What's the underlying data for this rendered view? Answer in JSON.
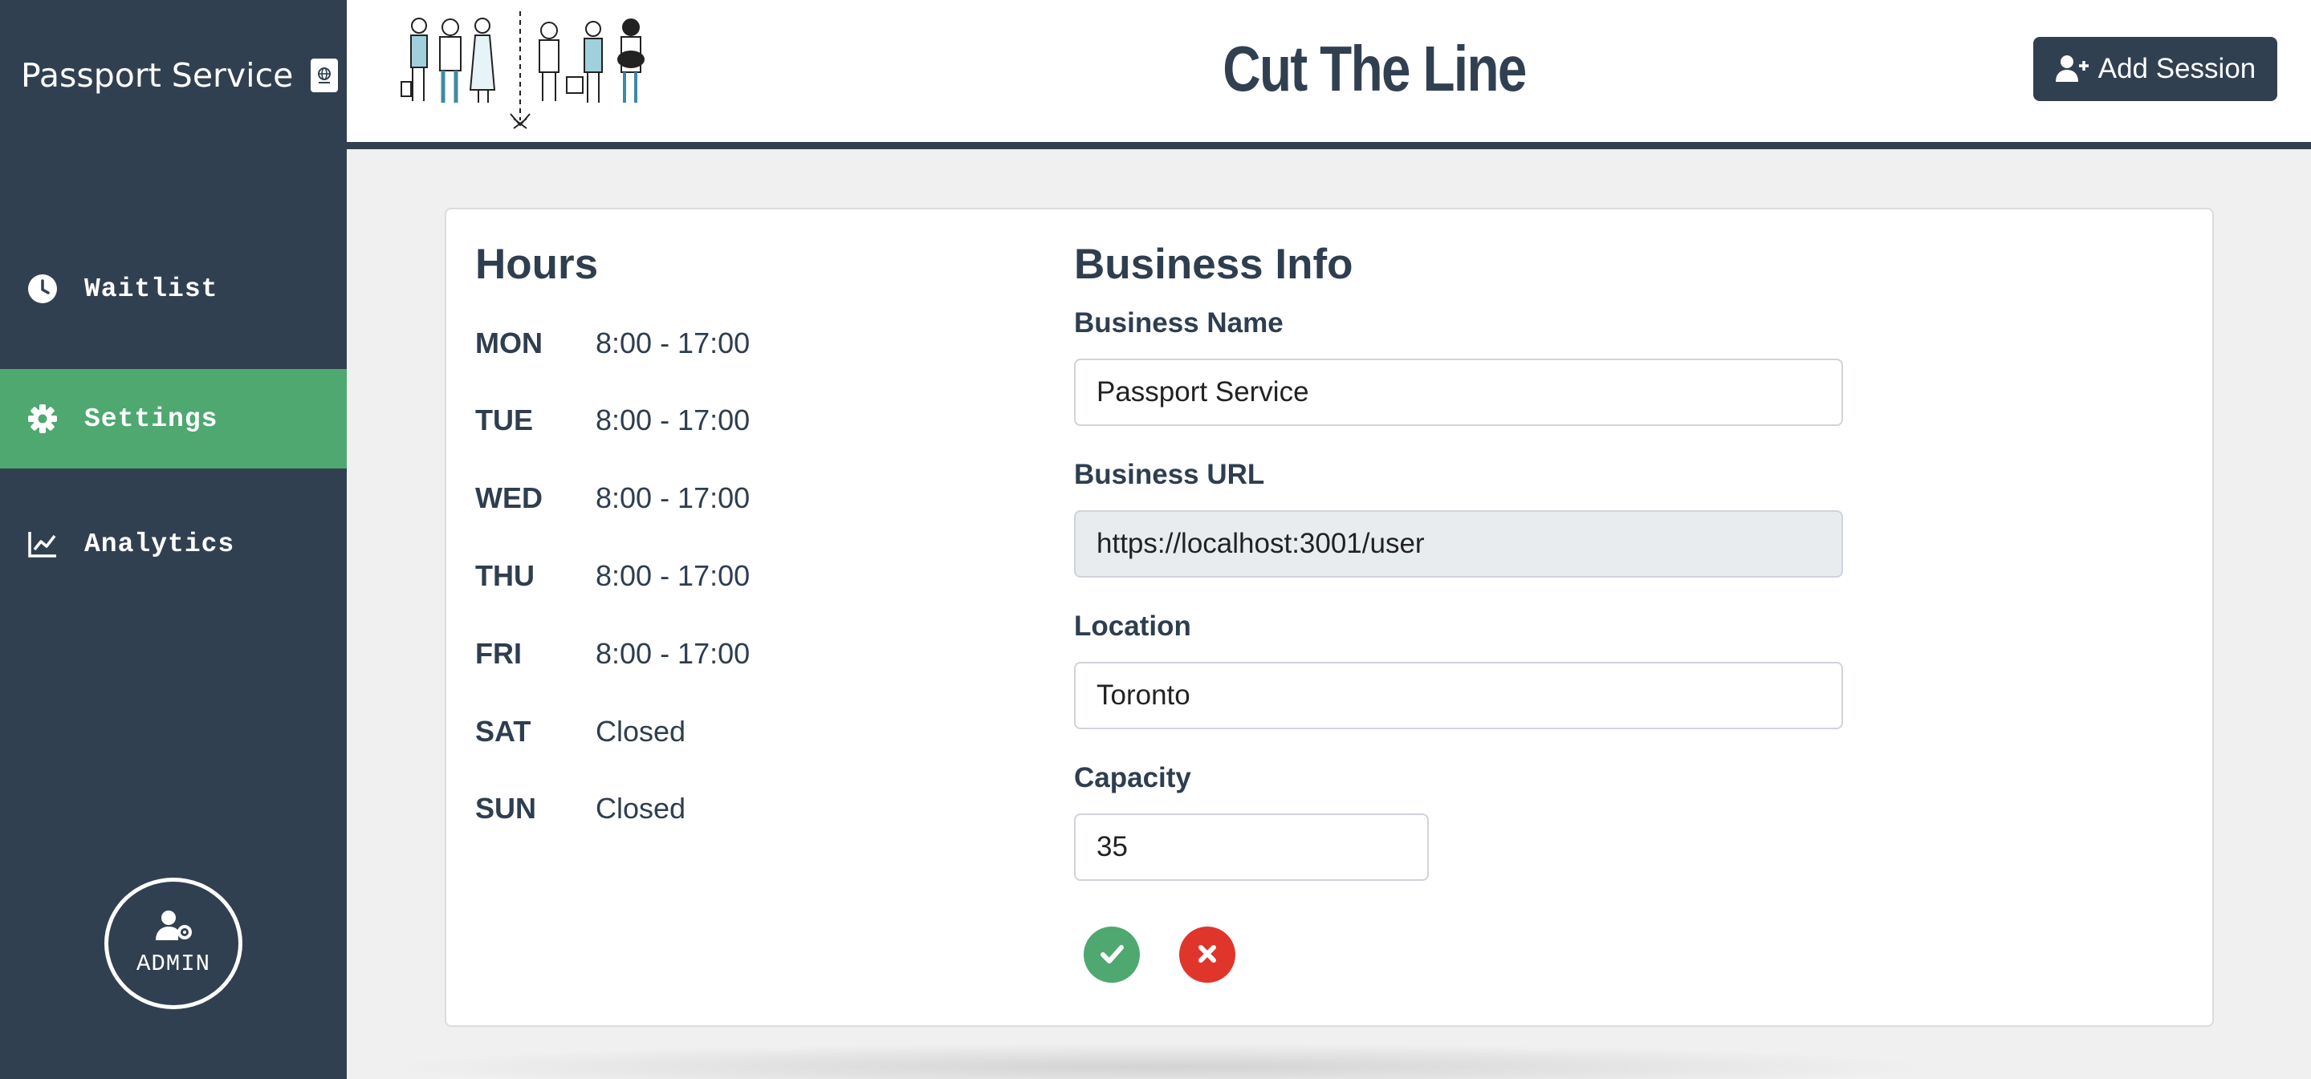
{
  "sidebar": {
    "brand": "Passport Service",
    "brand_icon": "passport-icon",
    "items": [
      {
        "label": "Waitlist",
        "icon": "clock-icon",
        "active": false
      },
      {
        "label": "Settings",
        "icon": "gear-icon",
        "active": true
      },
      {
        "label": "Analytics",
        "icon": "chart-line-icon",
        "active": false
      }
    ],
    "admin_label": "ADMIN",
    "admin_icon": "user-gear-icon"
  },
  "header": {
    "title": "Cut The Line",
    "add_session_label": "Add Session",
    "add_session_icon": "user-plus-icon",
    "illustration": "queue-people-illustration"
  },
  "hours": {
    "title": "Hours",
    "rows": [
      {
        "day": "MON",
        "time": "8:00 - 17:00"
      },
      {
        "day": "TUE",
        "time": "8:00 - 17:00"
      },
      {
        "day": "WED",
        "time": "8:00 - 17:00"
      },
      {
        "day": "THU",
        "time": "8:00 - 17:00"
      },
      {
        "day": "FRI",
        "time": "8:00 - 17:00"
      },
      {
        "day": "SAT",
        "time": "Closed"
      },
      {
        "day": "SUN",
        "time": "Closed"
      }
    ]
  },
  "business": {
    "title": "Business Info",
    "name_label": "Business Name",
    "name_value": "Passport Service",
    "url_label": "Business URL",
    "url_value": "https://localhost:3001/user",
    "location_label": "Location",
    "location_value": "Toronto",
    "capacity_label": "Capacity",
    "capacity_value": "35",
    "confirm_icon": "check-icon",
    "cancel_icon": "close-icon"
  },
  "colors": {
    "sidebar_bg": "#314051",
    "active_green": "#4ea870",
    "cancel_red": "#e0352b",
    "page_bg": "#f0f0f0"
  }
}
